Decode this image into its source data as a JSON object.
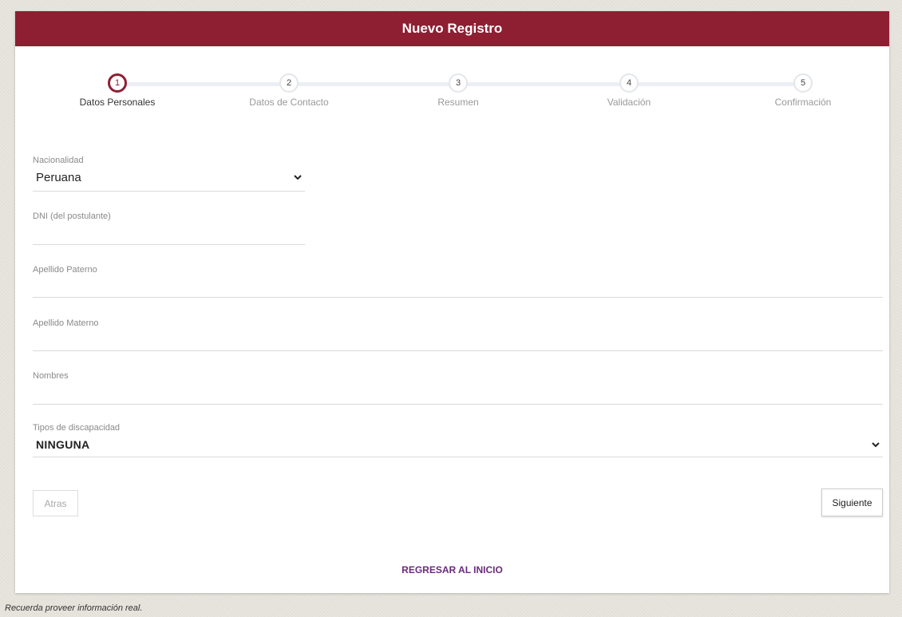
{
  "header": {
    "title": "Nuevo Registro"
  },
  "steps": [
    {
      "number": "1",
      "label": "Datos Personales",
      "active": true
    },
    {
      "number": "2",
      "label": "Datos de Contacto",
      "active": false
    },
    {
      "number": "3",
      "label": "Resumen",
      "active": false
    },
    {
      "number": "4",
      "label": "Validación",
      "active": false
    },
    {
      "number": "5",
      "label": "Confirmación",
      "active": false
    }
  ],
  "form": {
    "nacionalidad": {
      "label": "Nacionalidad",
      "value": "Peruana"
    },
    "dni": {
      "label": "DNI (del postulante)",
      "value": ""
    },
    "apellido_paterno": {
      "label": "Apellido Paterno",
      "value": ""
    },
    "apellido_materno": {
      "label": "Apellido Materno",
      "value": ""
    },
    "nombres": {
      "label": "Nombres",
      "value": ""
    },
    "discapacidad": {
      "label": "Tipos de discapacidad",
      "value": "NINGUNA"
    }
  },
  "buttons": {
    "back": "Atras",
    "next": "Siguiente"
  },
  "link": {
    "home": "REGRESAR AL INICIO"
  },
  "footer": {
    "note": "Recuerda proveer información real."
  },
  "colors": {
    "brand": "#8e1f33",
    "link": "#6b2a7d"
  }
}
